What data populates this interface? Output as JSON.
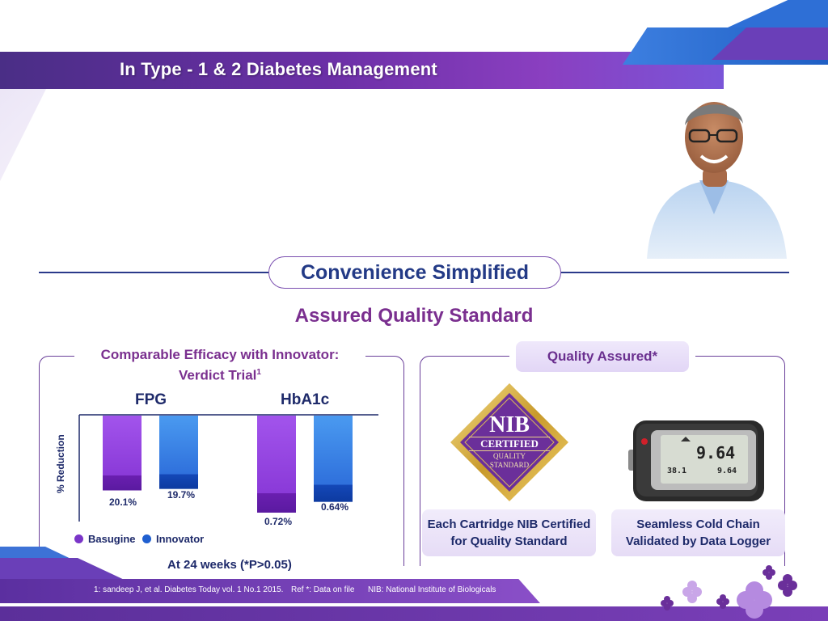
{
  "header": {
    "title": "In Type - 1 & 2 Diabetes Management"
  },
  "section": {
    "title": "Convenience Simplified",
    "subtitle": "Assured Quality Standard"
  },
  "efficacy": {
    "title_line1": "Comparable Efficacy with Innovator:",
    "title_line2": "Verdict Trial",
    "title_sup": "1",
    "y_axis_label": "% Reduction",
    "note": "At 24 weeks (*P>0.05)"
  },
  "chart_data": {
    "type": "bar",
    "categories": [
      "FPG",
      "HbA1c"
    ],
    "series": [
      {
        "name": "Basugine",
        "values": [
          20.1,
          0.72
        ],
        "labels": [
          "20.1%",
          "0.72%"
        ],
        "color": "#7a35c8"
      },
      {
        "name": "Innovator",
        "values": [
          19.7,
          0.64
        ],
        "labels": [
          "19.7%",
          "0.64%"
        ],
        "color": "#1f5fd0"
      }
    ],
    "ylabel": "% Reduction",
    "legend": "bottom-left"
  },
  "quality": {
    "title": "Quality Assured*",
    "badge": {
      "line1": "NIB",
      "line2": "CERTIFIED",
      "line3": "QUALITY",
      "line4": "STANDARD"
    },
    "logger_display": {
      "main": "9.64",
      "left": "38.1",
      "right": "9.64"
    },
    "cards": [
      {
        "line1": "Each Cartridge NIB Certified",
        "line2": "for Quality Standard"
      },
      {
        "line1": "Seamless Cold Chain",
        "line2": "Validated by Data Logger"
      }
    ]
  },
  "footer": {
    "reference": "1: sandeep J, et al. Diabetes Today vol. 1 No.1 2015.",
    "ref_note": "Ref *: Data on file",
    "abbreviation": "NIB: National Institute of Biologicals"
  },
  "colors": {
    "primary_purple": "#6b2fa6",
    "navy": "#233a86",
    "accent_blue": "#1f5fd0"
  }
}
